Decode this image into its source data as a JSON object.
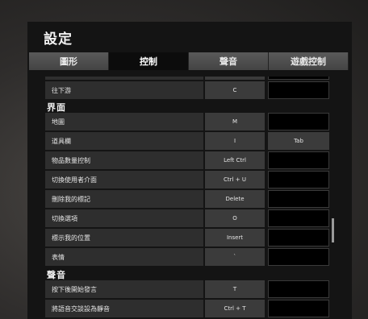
{
  "header": {
    "title": "設定"
  },
  "tabs": [
    {
      "label": "圖形"
    },
    {
      "label": "控制"
    },
    {
      "label": "聲音"
    },
    {
      "label": "遊戲控制"
    }
  ],
  "sections": [
    {
      "title": "界面"
    },
    {
      "title": "聲音"
    }
  ],
  "rows": [
    {
      "label": "往下游",
      "key1": "C",
      "key2": ""
    },
    {
      "label": "地圖",
      "key1": "M",
      "key2": ""
    },
    {
      "label": "道具欄",
      "key1": "I",
      "key2": "Tab"
    },
    {
      "label": "物品數量控制",
      "key1": "Left Ctrl",
      "key2": ""
    },
    {
      "label": "切換使用者介面",
      "key1": "Ctrl + U",
      "key2": ""
    },
    {
      "label": "刪除我的標記",
      "key1": "Delete",
      "key2": ""
    },
    {
      "label": "切換選項",
      "key1": "O",
      "key2": ""
    },
    {
      "label": "標示我的位置",
      "key1": "Insert",
      "key2": ""
    },
    {
      "label": "表情",
      "key1": "`",
      "key2": ""
    },
    {
      "label": "按下後開始發言",
      "key1": "T",
      "key2": ""
    },
    {
      "label": "將語音交談設為靜音",
      "key1": "Ctrl + T",
      "key2": ""
    }
  ]
}
